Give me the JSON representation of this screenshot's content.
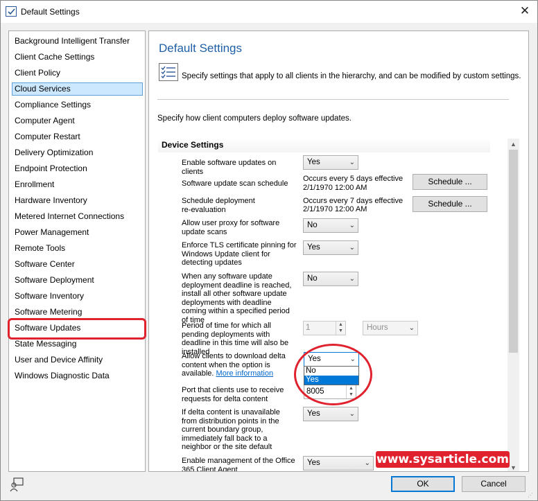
{
  "window": {
    "title": "Default Settings",
    "close": "✕"
  },
  "sidebar": {
    "items": [
      {
        "label": "Background Intelligent Transfer"
      },
      {
        "label": "Client Cache Settings"
      },
      {
        "label": "Client Policy"
      },
      {
        "label": "Cloud Services",
        "selected": true
      },
      {
        "label": "Compliance Settings"
      },
      {
        "label": "Computer Agent"
      },
      {
        "label": "Computer Restart"
      },
      {
        "label": "Delivery Optimization"
      },
      {
        "label": "Endpoint Protection"
      },
      {
        "label": "Enrollment"
      },
      {
        "label": "Hardware Inventory"
      },
      {
        "label": "Metered Internet Connections"
      },
      {
        "label": "Power Management"
      },
      {
        "label": "Remote Tools"
      },
      {
        "label": "Software Center"
      },
      {
        "label": "Software Deployment"
      },
      {
        "label": "Software Inventory"
      },
      {
        "label": "Software Metering"
      },
      {
        "label": "Software Updates",
        "highlighted": true
      },
      {
        "label": "State Messaging"
      },
      {
        "label": "User and Device Affinity"
      },
      {
        "label": "Windows Diagnostic Data"
      }
    ]
  },
  "main": {
    "title": "Default Settings",
    "description": "Specify settings that apply to all clients in the hierarchy, and can be modified by custom settings.",
    "deploy_text": "Specify how client computers deploy software updates.",
    "section_header": "Device Settings",
    "settings": {
      "enable_updates": {
        "label": "Enable software updates on clients",
        "value": "Yes"
      },
      "scan_schedule": {
        "label": "Software update scan schedule",
        "value_line1": "Occurs every 5 days effective",
        "value_line2": "2/1/1970 12:00 AM",
        "button": "Schedule ..."
      },
      "reevaluation": {
        "label": "Schedule deployment re-evaluation",
        "value_line1": "Occurs every 7 days effective",
        "value_line2": "2/1/1970 12:00 AM",
        "button": "Schedule ..."
      },
      "proxy": {
        "label": "Allow user proxy for software update scans",
        "value": "No"
      },
      "tls": {
        "label": "Enforce TLS certificate pinning for Windows Update client for detecting updates",
        "value": "Yes"
      },
      "deadline": {
        "label": "When any software update deployment deadline is reached, install all other software update deployments with deadline coming within a specified period of time",
        "value": "No"
      },
      "period": {
        "label": "Period of time for which all pending deployments with deadline in this time will also be installed",
        "value": "1",
        "unit": "Hours"
      },
      "delta": {
        "label": "Allow clients to download delta content when the option is available.",
        "link": "More information",
        "value": "Yes",
        "options": [
          "No",
          "Yes"
        ]
      },
      "port": {
        "label": "Port that clients use to receive requests for delta content",
        "value": "8005"
      },
      "fallback": {
        "label": "If delta content is unavailable from distribution points in the current boundary group, immediately fall back to a neighbor or the site default",
        "value": "Yes"
      },
      "o365": {
        "label": "Enable management of the Office 365 Client Agent",
        "value": "Yes"
      }
    }
  },
  "footer": {
    "ok": "OK",
    "cancel": "Cancel"
  },
  "watermark": "www.sysarticle.com",
  "colors": {
    "accent": "#0078d7",
    "title_blue": "#1f5fa8",
    "highlight_red": "#e0212e",
    "selection": "#cce8ff"
  },
  "icons": {
    "title": "settings-checklist-icon",
    "description": "checklist-icon",
    "feedback": "feedback-icon"
  }
}
